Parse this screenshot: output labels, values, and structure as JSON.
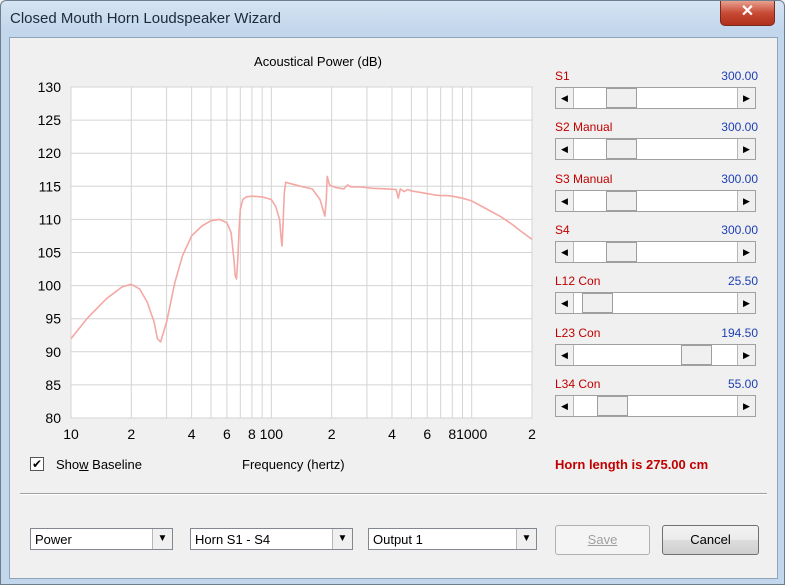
{
  "window": {
    "title": "Closed Mouth Horn Loudspeaker Wizard",
    "close_glyph": "✕"
  },
  "chart": {
    "title": "Acoustical Power (dB)",
    "x_label_prefix": "Sho",
    "show_baseline_label_u": "w",
    "show_baseline_label_rest": " Baseline",
    "show_baseline_checked": "✔",
    "xlabel": "Frequency (hertz)"
  },
  "chart_data": {
    "type": "line",
    "title": "Acoustical Power (dB)",
    "xlabel": "Frequency (hertz)",
    "ylabel": "",
    "xscale": "log",
    "xlim": [
      10,
      2000
    ],
    "ylim": [
      80,
      130
    ],
    "yticks": [
      80,
      85,
      90,
      95,
      100,
      105,
      110,
      115,
      120,
      125,
      130
    ],
    "xtick_labels": [
      "10",
      "2",
      "4",
      "6",
      "8",
      "100",
      "2",
      "4",
      "6",
      "8",
      "1000",
      "2"
    ],
    "xtick_values": [
      10,
      20,
      40,
      60,
      80,
      100,
      200,
      400,
      600,
      800,
      1000,
      2000
    ],
    "grid": true,
    "color": "#f4a8a4",
    "series": [
      {
        "x": [
          10,
          12,
          15,
          18,
          20,
          22,
          24,
          26,
          27,
          28,
          30,
          33,
          36,
          40,
          45,
          50,
          55,
          60,
          63,
          65,
          66,
          67,
          68,
          69,
          70,
          72,
          75,
          80,
          90,
          100,
          105,
          110,
          112,
          113,
          114,
          116,
          118,
          125,
          140,
          160,
          175,
          185,
          188,
          190,
          195,
          210,
          230,
          240,
          250,
          280,
          320,
          380,
          420,
          430,
          440,
          460,
          480,
          500,
          550,
          600,
          650,
          700,
          750,
          800,
          900,
          1000,
          1200,
          1400,
          1600,
          1800,
          2000
        ],
        "y": [
          92,
          95,
          98,
          99.8,
          100.2,
          99.5,
          97.5,
          94.5,
          92,
          91.5,
          94.5,
          100.5,
          104.5,
          107.5,
          109,
          109.8,
          110,
          109.5,
          108,
          104,
          101.5,
          101,
          104,
          108.5,
          111.5,
          113,
          113.4,
          113.5,
          113.4,
          113,
          112,
          110,
          107,
          106,
          108,
          114,
          115.6,
          115.4,
          115,
          114.6,
          113,
          110.5,
          113,
          116.5,
          115.2,
          114.8,
          114.6,
          115.2,
          114.9,
          114.9,
          114.7,
          114.6,
          114.5,
          113.2,
          114.6,
          114.2,
          114.5,
          114.3,
          114.1,
          113.9,
          113.7,
          113.6,
          113.6,
          113.5,
          113.2,
          112.8,
          111.5,
          110.4,
          109.2,
          108,
          107
        ]
      }
    ]
  },
  "sliders": [
    {
      "label": "S1",
      "value": "300.00",
      "fraction": 0.25
    },
    {
      "label": "S2 Manual",
      "value": "300.00",
      "fraction": 0.25
    },
    {
      "label": "S3 Manual",
      "value": "300.00",
      "fraction": 0.25
    },
    {
      "label": "S4",
      "value": "300.00",
      "fraction": 0.25
    },
    {
      "label": "L12 Con",
      "value": "25.50",
      "fraction": 0.07
    },
    {
      "label": "L23 Con",
      "value": "194.50",
      "fraction": 0.82
    },
    {
      "label": "L34 Con",
      "value": "55.00",
      "fraction": 0.18
    }
  ],
  "horn_length": "Horn length is 275.00 cm",
  "footer": {
    "combo_mode": "Power",
    "combo_horn": "Horn S1 - S4",
    "combo_output": "Output 1",
    "save_label": "Save",
    "cancel_label": "Cancel",
    "drop_glyph": "▼",
    "left_glyph": "◀",
    "right_glyph": "▶"
  }
}
